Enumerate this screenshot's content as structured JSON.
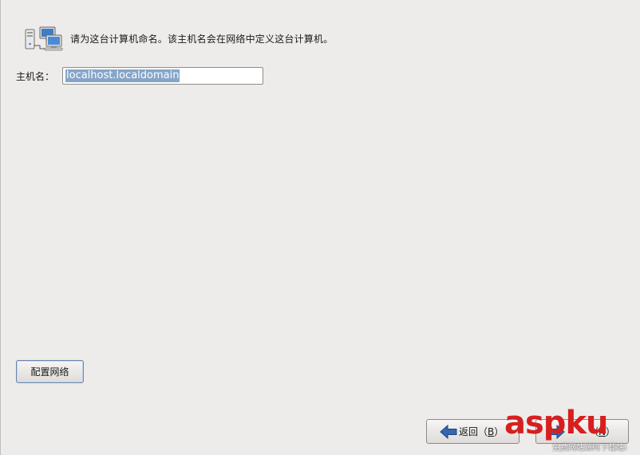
{
  "header": {
    "icon": "network-computers-icon",
    "text": "请为这台计算机命名。该主机名会在网络中定义这台计算机。"
  },
  "hostname": {
    "label": "主机名：",
    "value": "localhost.localdomain"
  },
  "buttons": {
    "configure_network": "配置网络",
    "back_prefix": "返回（",
    "back_key": "B",
    "back_suffix": "）",
    "next_prefix": "（",
    "next_key": "N",
    "next_suffix": "）"
  },
  "watermark": {
    "brand_a": "asp",
    "brand_b": "ku",
    "subtitle": "免费网站源码下载站!"
  },
  "colors": {
    "background": "#edeceb",
    "selection": "#86a5c8",
    "focus_border": "#6b87ad",
    "arrow": "#3566b0",
    "watermark_red": "#d61f1f"
  }
}
